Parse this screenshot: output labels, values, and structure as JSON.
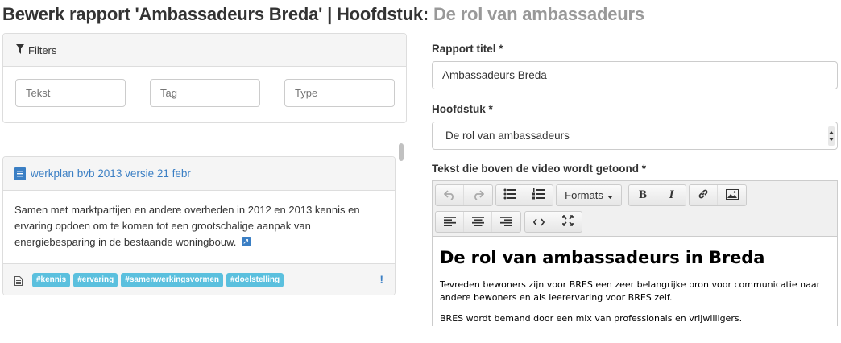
{
  "header": {
    "title_main": "Bewerk rapport 'Ambassadeurs Breda' | Hoofdstuk:",
    "title_sub": "De rol van ambassadeurs"
  },
  "filters": {
    "title": "Filters",
    "text_placeholder": "Tekst",
    "tag_placeholder": "Tag",
    "type_placeholder": "Type"
  },
  "result": {
    "title": "werkplan bvb 2013 versie 21 febr",
    "body": "Samen met marktpartijen en andere overheden in 2012 en 2013 kennis en ervaring opdoen om te komen tot een grootschalige aanpak van energiebesparing in de bestaande woningbouw.",
    "tags": [
      "#kennis",
      "#ervaring",
      "#samenwerkingsvormen",
      "#doelstelling"
    ],
    "alert": "!"
  },
  "form": {
    "report_title_label": "Rapport titel *",
    "report_title_value": "Ambassadeurs Breda",
    "chapter_label": "Hoofdstuk *",
    "chapter_value": "De rol van ambassadeurs",
    "text_label": "Tekst die boven de video wordt getoond *"
  },
  "editor": {
    "formats_label": "Formats",
    "heading": "De rol van ambassadeurs in Breda",
    "paragraph1": "Tevreden bewoners zijn voor BRES een zeer belangrijke bron voor communicatie naar andere bewoners en als leerervaring voor BRES zelf.",
    "paragraph2": "BRES wordt bemand door een mix van professionals en vrijwilligers."
  },
  "colors": {
    "link": "#3b7fc4",
    "tag_bg": "#5bc0de",
    "subtitle": "#999999"
  }
}
